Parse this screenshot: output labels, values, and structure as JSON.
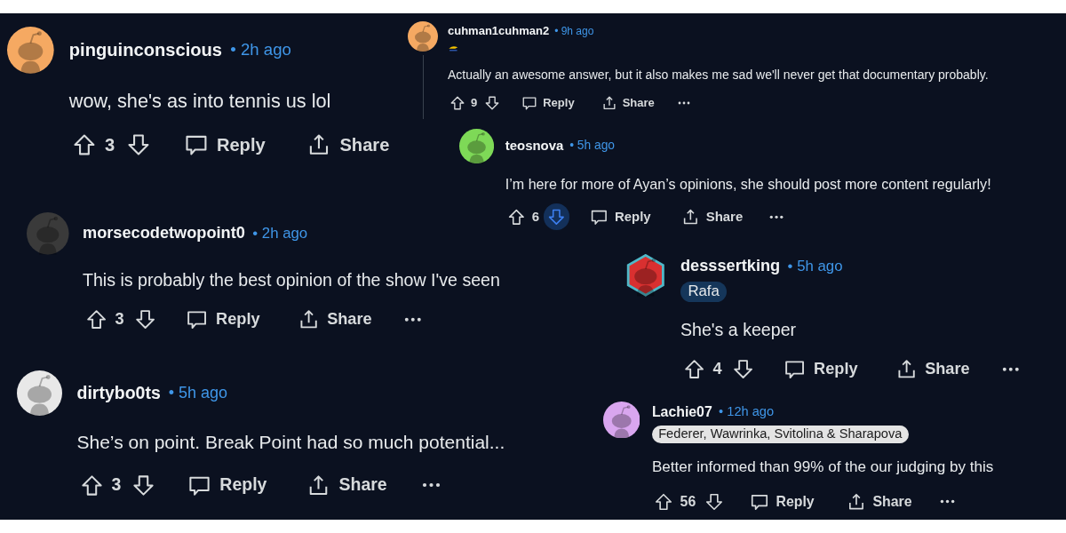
{
  "comments": [
    {
      "user": "pinguinconscious",
      "time": "• 2h ago",
      "avatar": {
        "kind": "circle",
        "color": "#f5a962"
      },
      "body": "wow, she's as into tennis us lol",
      "votes": "3",
      "downvote_highlighted": false,
      "reply": "Reply",
      "share": "Share",
      "more": false
    },
    {
      "user": "cuhman1cuhman2",
      "time": "• 9h ago",
      "avatar": {
        "kind": "circle",
        "color": "#f5a962"
      },
      "flair": {
        "kind": "icon"
      },
      "body": "Actually an awesome answer, but it also makes me sad we'll never get that documentary probably.",
      "votes": "9",
      "downvote_highlighted": false,
      "reply": "Reply",
      "share": "Share",
      "more": true
    },
    {
      "user": "teosnova",
      "time": "• 5h ago",
      "avatar": {
        "kind": "circle",
        "color": "#7ed957"
      },
      "body": "I’m here for more of Ayan’s opinions, she should post more content regularly!",
      "votes": "6",
      "downvote_highlighted": true,
      "reply": "Reply",
      "share": "Share",
      "more": true
    },
    {
      "user": "morsecodetwopoint0",
      "time": "• 2h ago",
      "avatar": {
        "kind": "circle",
        "color": "#3a3a3a"
      },
      "body": "This is probably the best opinion of the show I've seen",
      "votes": "3",
      "downvote_highlighted": false,
      "reply": "Reply",
      "share": "Share",
      "more": true
    },
    {
      "user": "dirtybo0ts",
      "time": "• 5h ago",
      "avatar": {
        "kind": "circle",
        "color": "#e8e8e8"
      },
      "body": "She’s on point. Break Point had so much potential...",
      "votes": "3",
      "downvote_highlighted": false,
      "reply": "Reply",
      "share": "Share",
      "more": true
    },
    {
      "user": "desssertking",
      "time": "• 5h ago",
      "avatar": {
        "kind": "hexagon",
        "color": "#d93030"
      },
      "flair": {
        "kind": "text",
        "text": "Rafa",
        "color": "#15365a"
      },
      "body": "She's a keeper",
      "votes": "4",
      "downvote_highlighted": false,
      "reply": "Reply",
      "share": "Share",
      "more": true
    },
    {
      "user": "Lachie07",
      "time": "• 12h ago",
      "avatar": {
        "kind": "circle",
        "color": "#d9a6ef"
      },
      "flair": {
        "kind": "text",
        "text": "Federer, Wawrinka, Svitolina & Sharapova",
        "color": "#e4e4e4"
      },
      "body": "Better informed than 99% of the our judging by this",
      "votes": "56",
      "downvote_highlighted": false,
      "reply": "Reply",
      "share": "Share",
      "more": true
    }
  ]
}
